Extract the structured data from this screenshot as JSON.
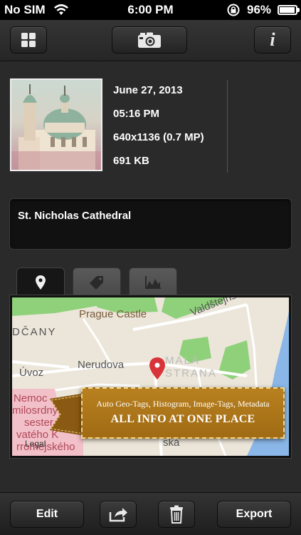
{
  "status_bar": {
    "carrier": "No SIM",
    "time": "6:00 PM",
    "battery": "96%",
    "battery_level": 0.96
  },
  "top_bar": {
    "icons": [
      "grid-icon",
      "camera-icon",
      "info-icon"
    ],
    "info_label": "i"
  },
  "photo": {
    "date": "June 27, 2013",
    "time": "05:16 PM",
    "dimensions": "640x1136 (0.7 MP)",
    "size": "691 KB",
    "title": "St. Nicholas Cathedral"
  },
  "tabs": [
    {
      "icon": "location-pin-icon",
      "active": true
    },
    {
      "icon": "tag-icon",
      "active": false
    },
    {
      "icon": "histogram-icon",
      "active": false
    }
  ],
  "map": {
    "labels": {
      "castle": "Prague Castle",
      "hradcany": "DČANY",
      "valdstejnska": "Valdštejnská",
      "nerudova": "Nerudova",
      "mala": "MALÁ",
      "strana": "STRANA",
      "uvoz": "Úvoz",
      "nemoc": "Nemoc",
      "milosrdnych": "milosrdnýc",
      "sester": "sester",
      "svateho": "vatého K",
      "borromejskeho": "rromejského",
      "ska": "ská",
      "legal": "Legal"
    },
    "colors": {
      "park": "#8fd17a",
      "water": "#8ab7e8",
      "road": "#ffffff",
      "pin": "#d8333a"
    }
  },
  "banner": {
    "subtitle": "Auto Geo-Tags, Histogram, Image-Tags, Metadata",
    "title": "ALL INFO AT ONE PLACE"
  },
  "bottom_bar": {
    "edit_label": "Edit",
    "export_label": "Export",
    "icons": [
      "share-icon",
      "trash-icon"
    ]
  }
}
